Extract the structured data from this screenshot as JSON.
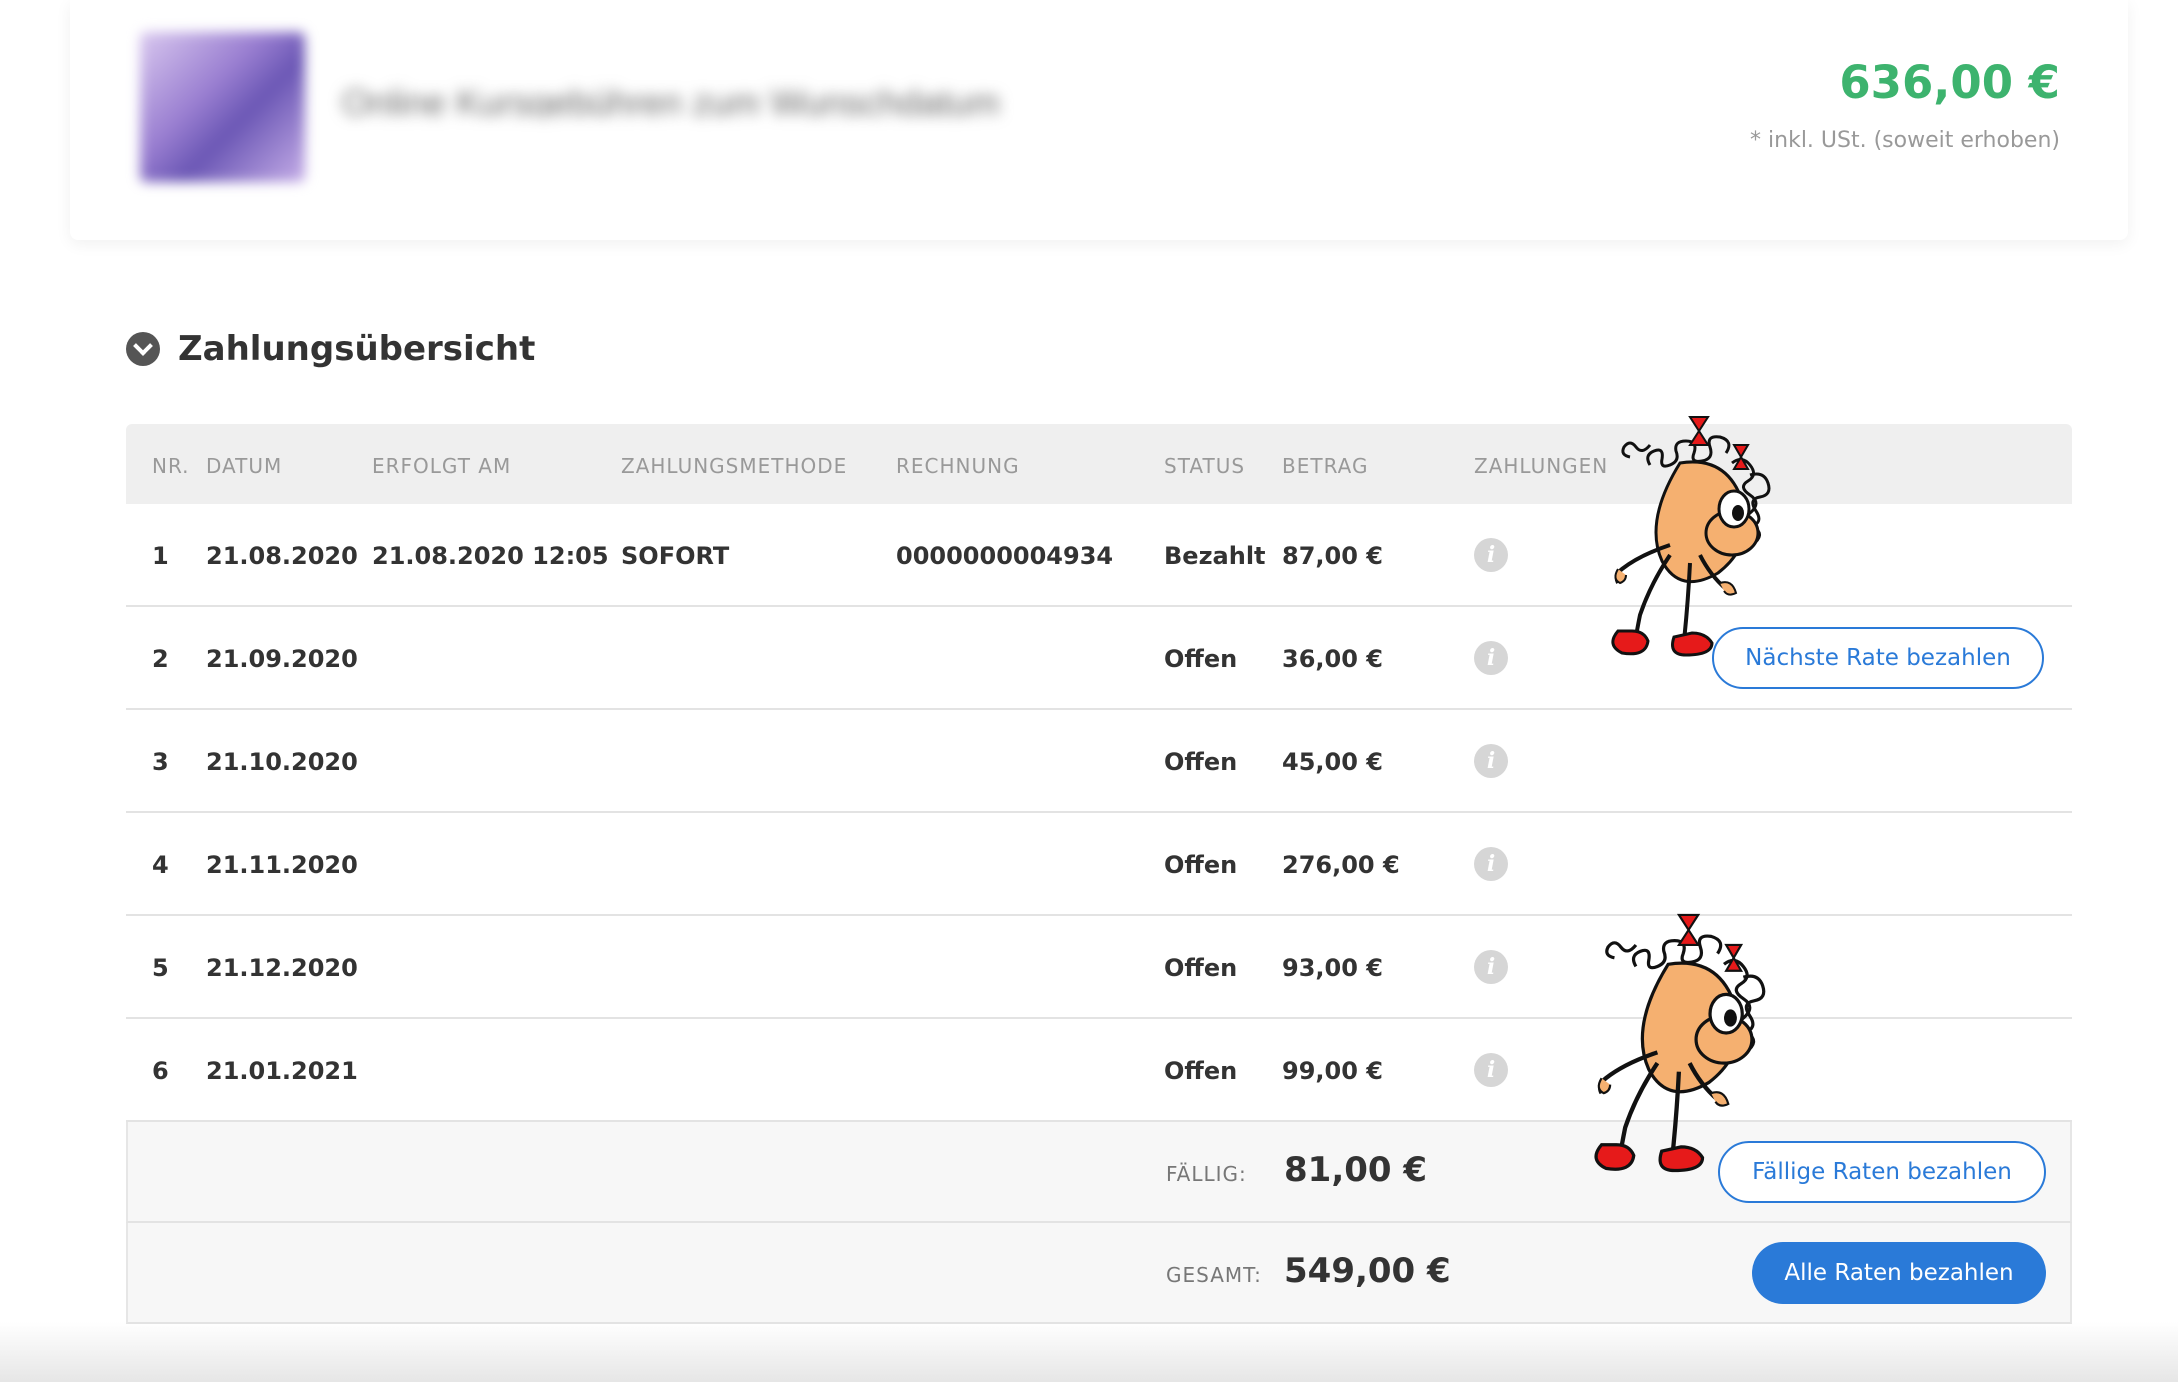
{
  "product": {
    "title": "Online Kursgebühren zum Wunschdatum",
    "price": "636,00 €",
    "price_note": "* inkl. USt. (soweit erhoben)"
  },
  "section": {
    "title": "Zahlungsübersicht",
    "icon": "chevron-down-circle-icon"
  },
  "table": {
    "headers": {
      "nr": "NR.",
      "datum": "DATUM",
      "erfolgt": "ERFOLGT AM",
      "methode": "ZAHLUNGSMETHODE",
      "rechnung": "RECHNUNG",
      "status": "STATUS",
      "betrag": "BETRAG",
      "zahlungen": "ZAHLUNGEN"
    },
    "rows": [
      {
        "nr": "1",
        "datum": "21.08.2020",
        "erfolgt": "21.08.2020 12:05",
        "methode": "SOFORT",
        "rechnung": "0000000004934",
        "status": "Bezahlt",
        "betrag": "87,00 €"
      },
      {
        "nr": "2",
        "datum": "21.09.2020",
        "erfolgt": "",
        "methode": "",
        "rechnung": "",
        "status": "Offen",
        "betrag": "36,00 €"
      },
      {
        "nr": "3",
        "datum": "21.10.2020",
        "erfolgt": "",
        "methode": "",
        "rechnung": "",
        "status": "Offen",
        "betrag": "45,00 €"
      },
      {
        "nr": "4",
        "datum": "21.11.2020",
        "erfolgt": "",
        "methode": "",
        "rechnung": "",
        "status": "Offen",
        "betrag": "276,00 €"
      },
      {
        "nr": "5",
        "datum": "21.12.2020",
        "erfolgt": "",
        "methode": "",
        "rechnung": "",
        "status": "Offen",
        "betrag": "93,00 €"
      },
      {
        "nr": "6",
        "datum": "21.01.2021",
        "erfolgt": "",
        "methode": "",
        "rechnung": "",
        "status": "Offen",
        "betrag": "99,00 €"
      }
    ],
    "info_icon_glyph": "i"
  },
  "buttons": {
    "next_rate": "Nächste Rate bezahlen",
    "due_rates": "Fällige Raten bezahlen",
    "all_rates": "Alle Raten bezahlen"
  },
  "summary": {
    "due_label": "FÄLLIG:",
    "due_value": "81,00 €",
    "total_label": "GESAMT:",
    "total_value": "549,00 €"
  },
  "colors": {
    "price_green": "#3db36e",
    "accent_blue": "#2a7ad8",
    "header_gray": "#efefef"
  }
}
